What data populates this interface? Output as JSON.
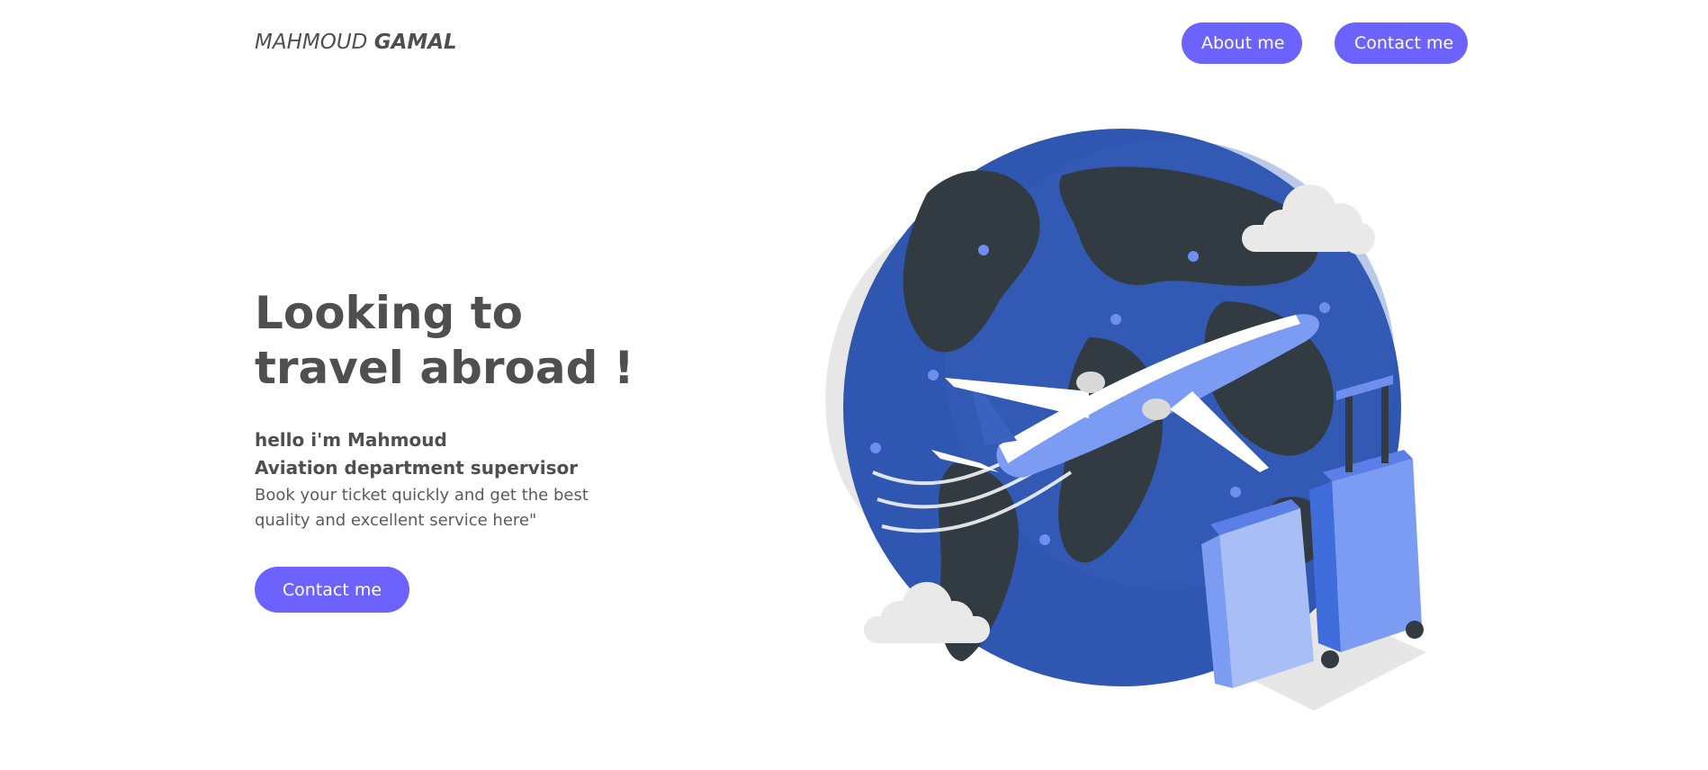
{
  "header": {
    "logo_first": "MAHMOUD",
    "logo_last": "GAMAL",
    "nav": {
      "about_label": "About me",
      "contact_label": "Contact me"
    }
  },
  "hero": {
    "title_line1": "Looking to",
    "title_line2": "travel abroad !",
    "intro_line1": "hello i'm Mahmoud",
    "intro_line2": "Aviation department supervisor",
    "description": "Book your ticket quickly and get the best quality and excellent service here\"",
    "cta_label": "Contact me"
  },
  "illustration": {
    "icon": "travel-globe-airplane-luggage-illustration"
  },
  "colors": {
    "accent": "#6c63ff",
    "text": "#4f4f4f",
    "globe_ocean": "#2f56b0",
    "globe_land": "#323a42",
    "plane_blue": "#7b9cf2"
  }
}
